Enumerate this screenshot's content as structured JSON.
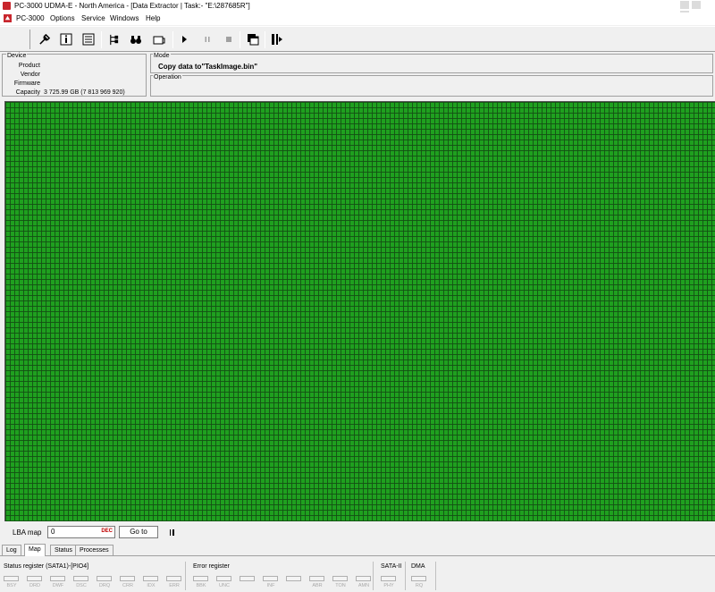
{
  "window": {
    "title": "PC-3000 UDMA-E - North America - [Data Extractor | Task:- \"E:\\287685R\"]"
  },
  "menu": {
    "items": [
      "PC-3000",
      "Options",
      "Service",
      "Windows",
      "Help"
    ]
  },
  "toolbar": {
    "buttons": [
      {
        "name": "tools-icon",
        "glyph": "⚒"
      },
      {
        "name": "info-icon",
        "glyph": "ℹ"
      },
      {
        "name": "sector-icon",
        "glyph": "▦"
      },
      {
        "name": "tree-icon",
        "glyph": "⋔"
      },
      {
        "name": "search-binoculars-icon",
        "glyph": "⚲"
      },
      {
        "name": "copy-icon",
        "glyph": "❐"
      },
      {
        "name": "play-icon",
        "glyph": "▶"
      },
      {
        "name": "pause-icon",
        "glyph": "Ⅱ"
      },
      {
        "name": "stop-icon",
        "glyph": "■"
      },
      {
        "name": "windows-icon",
        "glyph": "▣"
      },
      {
        "name": "exit-icon",
        "glyph": "⇥"
      }
    ]
  },
  "device": {
    "caption": "Device",
    "product_label": "Product",
    "product_value": "",
    "vendor_label": "Vendor",
    "vendor_value": "",
    "firmware_label": "Firmware",
    "firmware_value": "",
    "capacity_label": "Capacity",
    "capacity_value": "3 725.99 GB (7 813 969 920)"
  },
  "mode": {
    "caption": "Mode",
    "value": "Copy data to\"TaskImage.bin\""
  },
  "operation": {
    "caption": "Operation",
    "value": ""
  },
  "map": {
    "cell_color": "#1fa01f",
    "grid_color": "#145014"
  },
  "lba": {
    "label": "LBA map",
    "value": "0",
    "dec_label": "DEC",
    "goto_label": "Go to"
  },
  "tabs": [
    {
      "label": "Log",
      "active": false
    },
    {
      "label": "Map",
      "active": true
    },
    {
      "label": "Status",
      "active": false
    },
    {
      "label": "Processes",
      "active": false
    }
  ],
  "registers": {
    "status_title": "Status register (SATA1)-[PIO4]",
    "status_bits": [
      "BSY",
      "DRD",
      "DWF",
      "DSC",
      "DRQ",
      "CRR",
      "IDX",
      "ERR"
    ],
    "error_title": "Error register",
    "error_bits": [
      "BBK",
      "UNC",
      "",
      "INF",
      "",
      "ABR",
      "TON",
      "AMN"
    ],
    "sata_title": "SATA-II",
    "sata_bits": [
      "PHY"
    ],
    "dma_title": "DMA",
    "dma_bits": [
      "RQ"
    ]
  }
}
